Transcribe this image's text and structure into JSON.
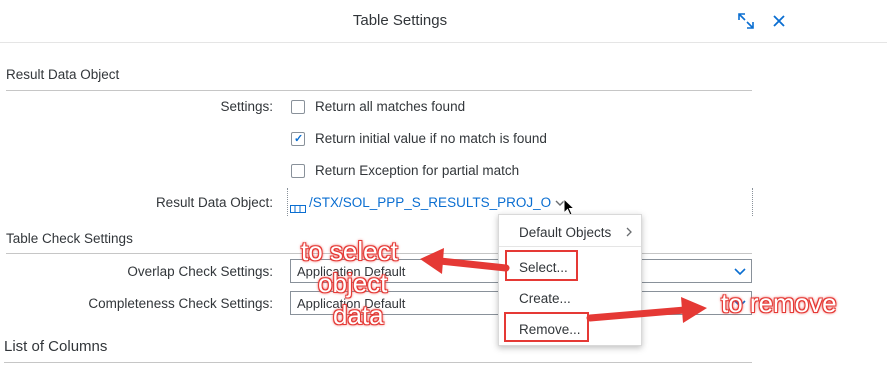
{
  "dialog": {
    "title": "Table Settings",
    "expand_icon": "expand-icon",
    "close_icon": "close-icon"
  },
  "result_section": {
    "title": "Result Data Object",
    "settings_label": "Settings:",
    "options": [
      {
        "label": "Return all matches found",
        "checked": false
      },
      {
        "label": "Return initial value if no match is found",
        "checked": true
      },
      {
        "label": "Return Exception for partial match",
        "checked": false
      }
    ],
    "result_label": "Result Data Object:",
    "result_value": "/STX/SOL_PPP_S_RESULTS_PROJ_O"
  },
  "check_section": {
    "title": "Table Check Settings",
    "overlap_label": "Overlap Check Settings:",
    "overlap_value": "Application Default",
    "completeness_label": "Completeness Check Settings:",
    "completeness_value": "Application Default"
  },
  "columns_section": {
    "title": "List of Columns"
  },
  "context_menu": {
    "items": [
      "Default Objects",
      "Select...",
      "Create...",
      "Remove..."
    ]
  },
  "annotations": {
    "select_line1": "to select",
    "select_line2": "object",
    "select_line3": "data",
    "remove": "to remove"
  },
  "colors": {
    "accent": "#0a6ed1",
    "annotation_red": "#e53935"
  }
}
